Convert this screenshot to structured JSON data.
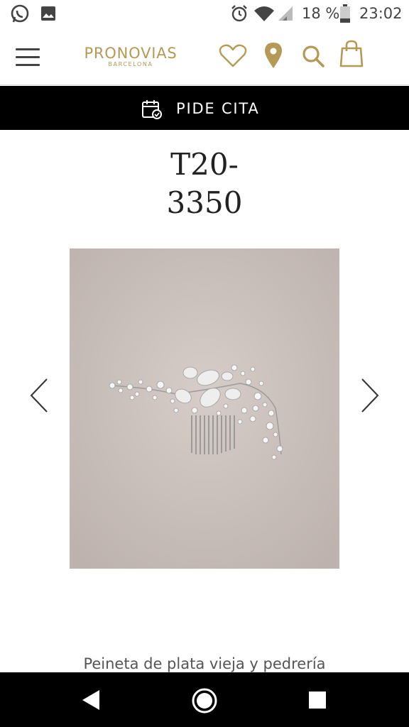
{
  "status_bar": {
    "battery_percent": "18 %",
    "time": "23:02",
    "icons": [
      "whatsapp-icon",
      "gallery-icon",
      "alarm-icon",
      "wifi-icon",
      "signal-icon",
      "battery-icon"
    ]
  },
  "header": {
    "brand": "PRONOVIAS",
    "brand_sub": "BARCELONA",
    "icons": [
      "menu-icon",
      "heart-icon",
      "location-pin-icon",
      "search-icon",
      "shopping-bag-icon"
    ],
    "accent_color": "#b59a55"
  },
  "appointment_bar": {
    "label": "PIDE CITA",
    "icon": "calendar-check-icon"
  },
  "product": {
    "title_line1": "T20-",
    "title_line2": "3350",
    "image_description": "",
    "description": "Peineta de plata vieja y pedrería"
  },
  "carousel": {
    "prev_icon": "chevron-left-icon",
    "next_icon": "chevron-right-icon"
  },
  "android_nav": {
    "icons": [
      "back-icon",
      "home-icon",
      "recents-icon"
    ]
  }
}
